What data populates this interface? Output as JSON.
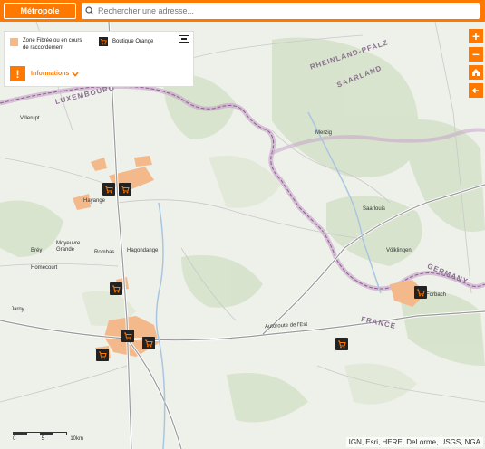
{
  "topbar": {
    "metro_label": "Métropole",
    "search_placeholder": "Rechercher une adresse..."
  },
  "legend": {
    "fibre_label": "Zone Fibrée ou en cours de raccordement",
    "shop_label": "Boutique Orange",
    "info_label": "Informations"
  },
  "controls": {
    "zoom_in": "+",
    "zoom_out": "−"
  },
  "attribution": "IGN, Esri, HERE, DeLorme, USGS, NGA",
  "scale": {
    "labels": [
      "0",
      "5",
      "10km"
    ]
  },
  "map_labels": {
    "regions": [
      "LUXEMBOURG",
      "RHEINLAND-PFALZ",
      "SAARLAND",
      "GERMANY",
      "FRANCE"
    ],
    "places": [
      "Villerupt",
      "Merzig",
      "Hayange",
      "Saarlouis",
      "Bréy",
      "Moyeuvre Grande",
      "Rombas",
      "Hagondange",
      "Homécourt",
      "Völklingen",
      "Jarny",
      "Forbach",
      "Autoroute de l'Est"
    ]
  },
  "colors": {
    "accent": "#ff7900",
    "fibre": "#f3b98a",
    "border": "#b589b5"
  }
}
